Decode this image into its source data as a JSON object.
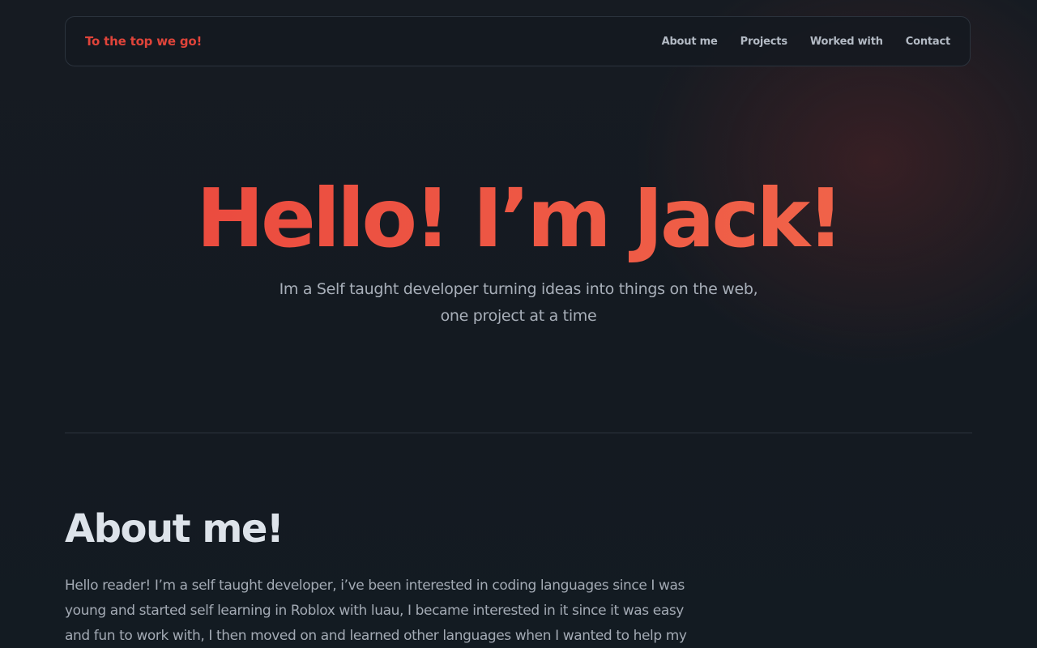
{
  "nav": {
    "brand": "To the top we go!",
    "links": [
      {
        "label": "About me"
      },
      {
        "label": "Projects"
      },
      {
        "label": "Worked with"
      },
      {
        "label": "Contact"
      }
    ]
  },
  "hero": {
    "title": "Hello! I’m Jack!",
    "subtitle": "Im a Self taught developer turning ideas into things on the web, one project at a time"
  },
  "about": {
    "heading": "About me!",
    "text": "Hello reader! I’m a self taught developer, i’ve been interested in coding languages since I was young and started self learning in Roblox with luau, I became interested in it since it was easy and fun to work with, I then moved on and learned other languages when I wanted to help my"
  },
  "colors": {
    "accent": "#e0443a",
    "background": "#161b22"
  }
}
